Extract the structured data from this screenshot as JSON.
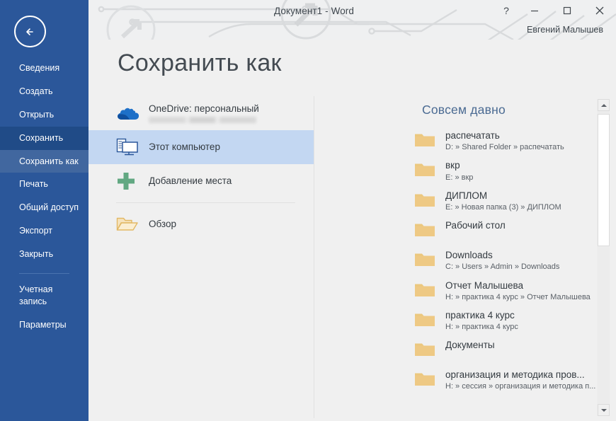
{
  "window": {
    "doc_title": "Документ1 - Word",
    "user_name": "Евгений Малышев",
    "help_label": "?",
    "minimize_label": "minimize",
    "maximize_label": "maximize",
    "close_label": "close",
    "back_label": "back"
  },
  "sidebar": {
    "bg_color": "#2b579a",
    "hover_color": "#204b87",
    "selected_color": "#41679f",
    "items": [
      {
        "label": "Сведения",
        "state": "normal"
      },
      {
        "label": "Создать",
        "state": "normal"
      },
      {
        "label": "Открыть",
        "state": "normal"
      },
      {
        "label": "Сохранить",
        "state": "hovered"
      },
      {
        "label": "Сохранить как",
        "state": "selected"
      },
      {
        "label": "Печать",
        "state": "normal"
      },
      {
        "label": "Общий доступ",
        "state": "normal"
      },
      {
        "label": "Экспорт",
        "state": "normal"
      },
      {
        "label": "Закрыть",
        "state": "normal"
      }
    ],
    "items_after_sep": [
      {
        "label": "Учетная\nзапись",
        "state": "normal"
      },
      {
        "label": "Параметры",
        "state": "normal"
      }
    ]
  },
  "main": {
    "page_title": "Сохранить как",
    "places": [
      {
        "label": "OneDrive: персональный",
        "icon": "onedrive-cloud-icon",
        "sub_redacted": true,
        "selected": false
      },
      {
        "label": "Этот компьютер",
        "icon": "this-pc-icon",
        "sub_redacted": false,
        "selected": true
      },
      {
        "label": "Добавление места",
        "icon": "add-place-plus-icon",
        "sub_redacted": false,
        "selected": false
      },
      {
        "label": "Обзор",
        "icon": "open-folder-icon",
        "sub_redacted": false,
        "selected": false
      }
    ],
    "recent": {
      "heading": "Совсем давно",
      "heading_color": "#4a6a92",
      "folders": [
        {
          "name": "распечатать",
          "path": "D: » Shared Folder » распечатать"
        },
        {
          "name": "вкр",
          "path": "E: » вкр"
        },
        {
          "name": "ДИПЛОМ",
          "path": "E: » Новая папка (3) » ДИПЛОМ"
        },
        {
          "name": "Рабочий стол",
          "path": ""
        },
        {
          "name": "Downloads",
          "path": "C: » Users » Admin » Downloads"
        },
        {
          "name": "Отчет Малышева",
          "path": "H: » практика 4 курс » Отчет Малышева"
        },
        {
          "name": "практика 4 курс",
          "path": "H: » практика 4 курс"
        },
        {
          "name": "Документы",
          "path": ""
        },
        {
          "name": "организация и методика пров...",
          "path": "H: » сессия » организация и методика п..."
        }
      ]
    }
  }
}
